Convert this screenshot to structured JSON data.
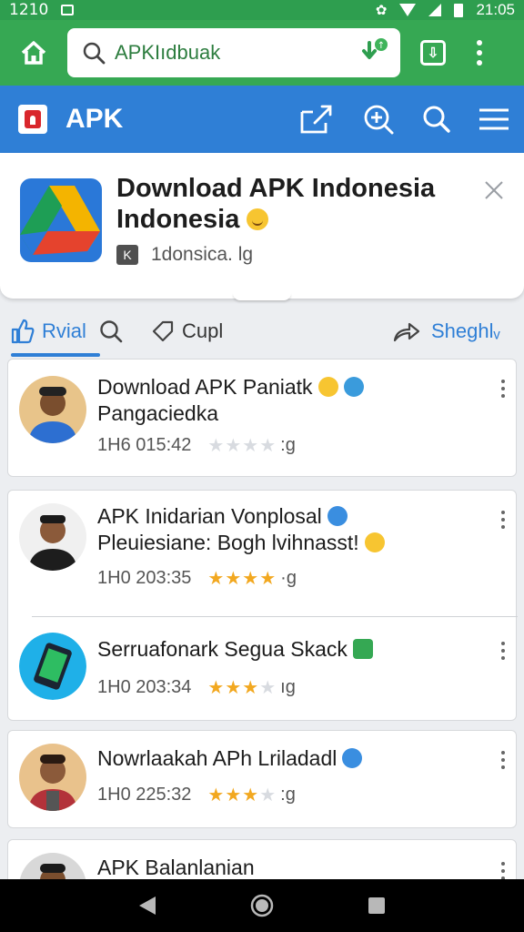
{
  "status_bar": {
    "time_left": "1210",
    "time_right": "21:05"
  },
  "browser": {
    "url": "APKIıdbuak"
  },
  "app": {
    "title": "APK"
  },
  "banner": {
    "title_line1": "Download APK Indonesia",
    "title_line2": "Indonesia",
    "meta": "1donsica. lg"
  },
  "tabs": {
    "active": "Rvial",
    "second": "Cupl",
    "share": "Sheghlᵥ"
  },
  "feed": [
    {
      "title": "Download APK Paniatk",
      "title2": "Pangaciedka",
      "time": "1H6 015:42",
      "rating": 0,
      "suffix": ":g",
      "badge": "blue-shield"
    },
    {
      "title": "APK Inidarian Vonplosal",
      "title2": "Pleuiesiane: Bogh lvihnasst!",
      "time": "1H0 203:35",
      "rating": 4,
      "suffix": "·g",
      "badge": "blue-download"
    },
    {
      "title": "Serruafonark Segua Skack",
      "title2": "",
      "time": "1H0 203:34",
      "rating": 3,
      "suffix": "ıg",
      "badge": "green-download"
    },
    {
      "title": "Nowrlaakah APh Lriladadl",
      "title2": "",
      "time": "1H0 225:32",
      "rating": 3,
      "suffix": ":g",
      "badge": "blue-shield"
    },
    {
      "title": "APK Balanlanian",
      "title2": "",
      "time": "",
      "rating": 0,
      "suffix": "",
      "badge": ""
    }
  ],
  "colors": {
    "browser_green": "#36a853",
    "header_blue": "#2f7fd6",
    "star": "#f2a820"
  }
}
